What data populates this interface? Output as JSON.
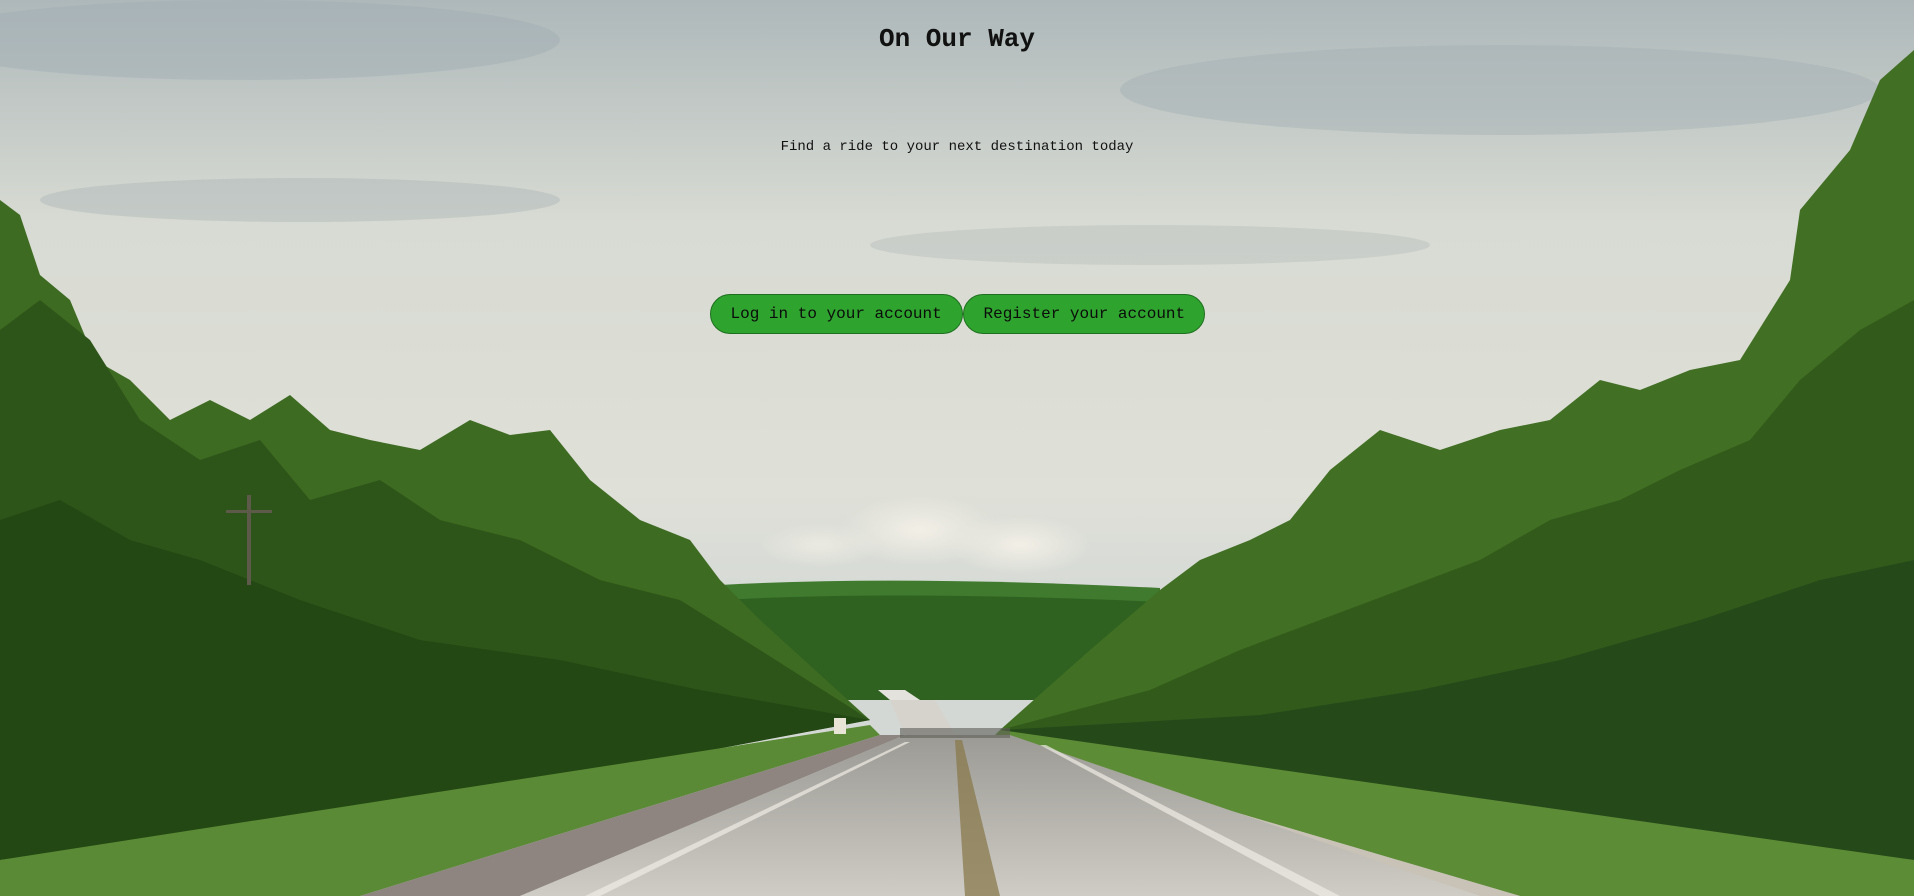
{
  "header": {
    "title": "On Our Way",
    "tagline": "Find a ride to your next destination today"
  },
  "actions": {
    "login_label": "Log in to your account",
    "register_label": "Register your account"
  },
  "colors": {
    "button_fill": "#2ea32e",
    "button_border": "#1e6f1e",
    "text": "#111111",
    "sky": "#d6d9d2",
    "forest": "#3f6e24",
    "road": "#c9c6c0"
  }
}
